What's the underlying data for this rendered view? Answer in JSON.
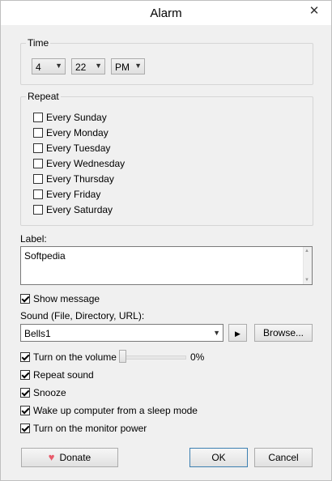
{
  "window": {
    "title": "Alarm",
    "close_glyph": "✕"
  },
  "time": {
    "label": "Time",
    "hour": "4",
    "minute": "22",
    "ampm": "PM"
  },
  "repeat": {
    "label": "Repeat",
    "days": [
      {
        "label": "Every Sunday",
        "checked": false
      },
      {
        "label": "Every Monday",
        "checked": false
      },
      {
        "label": "Every Tuesday",
        "checked": false
      },
      {
        "label": "Every Wednesday",
        "checked": false
      },
      {
        "label": "Every Thursday",
        "checked": false
      },
      {
        "label": "Every Friday",
        "checked": false
      },
      {
        "label": "Every Saturday",
        "checked": false
      }
    ]
  },
  "label_field": {
    "caption": "Label:",
    "value": "Softpedia"
  },
  "show_message": {
    "label": "Show message",
    "checked": true
  },
  "sound": {
    "caption": "Sound (File, Directory, URL):",
    "value": "Bells1",
    "play_glyph": "▶",
    "browse_label": "Browse..."
  },
  "volume": {
    "label": "Turn on the volume",
    "checked": true,
    "value_text": "0%"
  },
  "options": [
    {
      "label": "Repeat sound",
      "checked": true
    },
    {
      "label": "Snooze",
      "checked": true
    },
    {
      "label": "Wake up computer from a sleep mode",
      "checked": true
    },
    {
      "label": "Turn on the monitor power",
      "checked": true
    }
  ],
  "buttons": {
    "donate": "Donate",
    "ok": "OK",
    "cancel": "Cancel"
  },
  "icons": {
    "heart": "heart-icon",
    "play": "play-icon",
    "dropdown": "chevron-down-icon"
  }
}
